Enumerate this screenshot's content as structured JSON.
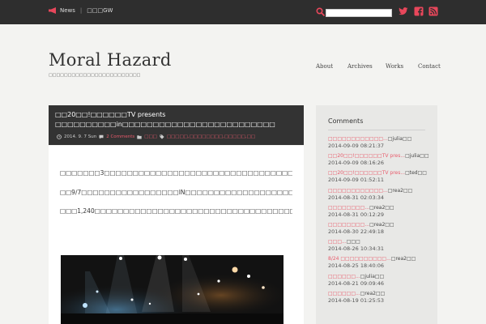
{
  "topbar": {
    "news_label": "News",
    "news_text": "□□□GW",
    "search": {
      "value": "",
      "placeholder": ""
    },
    "accent": "#e8475b"
  },
  "header": {
    "site_title": "Moral Hazard",
    "tagline": "□□□□□□□□□□□□□□□□□□□□□□□□",
    "nav": [
      "About",
      "Archives",
      "Works",
      "Contact"
    ]
  },
  "post": {
    "title": "□□20□□!□□□□□□TV presents □□□□□□□□□□in□□□□□□□□□□□□□□□□□□□□□□□□□",
    "date": "2014. 9. 7 Sun",
    "comments": "2 Comments",
    "category": "□□□",
    "tags": "□□□□□,□□□□□□□□,□□□□□,□□",
    "paragraphs": [
      "□□□□□□□3□□□□□□□□□□□□□□□□□□□□□□□□□□□□□□□□□□□□□□□□□□□□□□□□□□□□□□□□□□□□□□□□□□□□□□□□□",
      "□□9/7□□□□□□□□□□□□□□□□□IN□□□□□□□□□□□□□□□□□□□□□□□□□□□□□□□□□□□□□□□□□□□□□□",
      "□□□1,240□□□□□□□□□□□□□□□□□□□□□□□□□□□□□□□□□□□"
    ]
  },
  "sidebar": {
    "title": "Comments",
    "comments": [
      {
        "link": "□□□□□□□□□□□□...",
        "author": "□julia□□",
        "date": "2014-09-09 08:21:37"
      },
      {
        "link": "□□20□□!□□□□□□TV pres...",
        "author": "□julia□□",
        "date": "2014-09-09 08:16:26"
      },
      {
        "link": "□□20□□!□□□□□□TV pres...",
        "author": "□ted□□",
        "date": "2014-09-09 01:52:11"
      },
      {
        "link": "□□□□□□□□□□□□...",
        "author": "□rea2□□",
        "date": "2014-08-31 02:03:34"
      },
      {
        "link": "□□□□□□□□...",
        "author": "□rea2□□",
        "date": "2014-08-31 00:12:29"
      },
      {
        "link": "□□□□□□□□...",
        "author": "□rea2□□",
        "date": "2014-08-30 22:49:18"
      },
      {
        "link": "□□□...",
        "author": "□□□",
        "date": "2014-08-26 10:34:31"
      },
      {
        "link": "8/24 □□□□□□□□□□...",
        "author": "□rea2□□",
        "date": "2014-08-25 18:40:06"
      },
      {
        "link": "□□□□□□...",
        "author": "□julia□□",
        "date": "2014-08-21 09:09:46"
      },
      {
        "link": "□□□□□□...",
        "author": "□rea2□□",
        "date": "2014-08-19 01:25:53"
      }
    ]
  }
}
